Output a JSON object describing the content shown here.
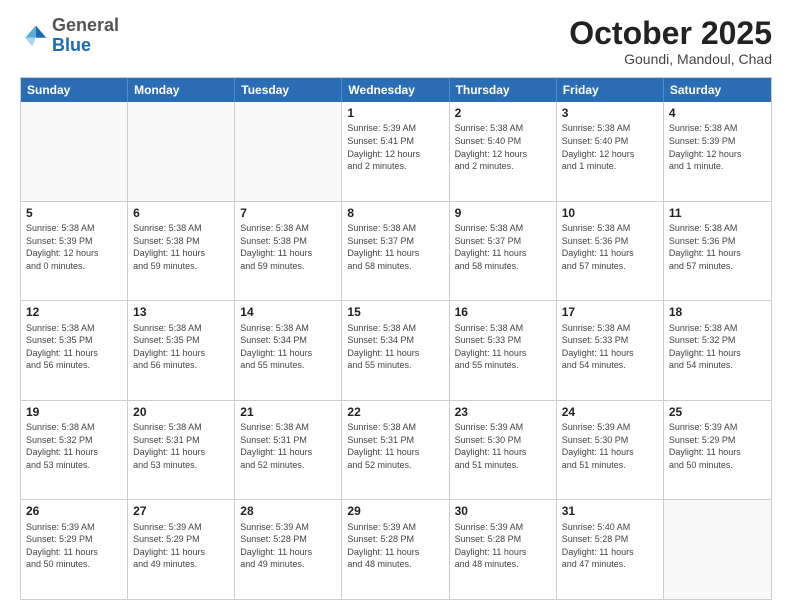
{
  "header": {
    "logo_general": "General",
    "logo_blue": "Blue",
    "month_title": "October 2025",
    "location": "Goundi, Mandoul, Chad"
  },
  "weekdays": [
    "Sunday",
    "Monday",
    "Tuesday",
    "Wednesday",
    "Thursday",
    "Friday",
    "Saturday"
  ],
  "rows": [
    [
      {
        "day": "",
        "info": ""
      },
      {
        "day": "",
        "info": ""
      },
      {
        "day": "",
        "info": ""
      },
      {
        "day": "1",
        "info": "Sunrise: 5:39 AM\nSunset: 5:41 PM\nDaylight: 12 hours\nand 2 minutes."
      },
      {
        "day": "2",
        "info": "Sunrise: 5:38 AM\nSunset: 5:40 PM\nDaylight: 12 hours\nand 2 minutes."
      },
      {
        "day": "3",
        "info": "Sunrise: 5:38 AM\nSunset: 5:40 PM\nDaylight: 12 hours\nand 1 minute."
      },
      {
        "day": "4",
        "info": "Sunrise: 5:38 AM\nSunset: 5:39 PM\nDaylight: 12 hours\nand 1 minute."
      }
    ],
    [
      {
        "day": "5",
        "info": "Sunrise: 5:38 AM\nSunset: 5:39 PM\nDaylight: 12 hours\nand 0 minutes."
      },
      {
        "day": "6",
        "info": "Sunrise: 5:38 AM\nSunset: 5:38 PM\nDaylight: 11 hours\nand 59 minutes."
      },
      {
        "day": "7",
        "info": "Sunrise: 5:38 AM\nSunset: 5:38 PM\nDaylight: 11 hours\nand 59 minutes."
      },
      {
        "day": "8",
        "info": "Sunrise: 5:38 AM\nSunset: 5:37 PM\nDaylight: 11 hours\nand 58 minutes."
      },
      {
        "day": "9",
        "info": "Sunrise: 5:38 AM\nSunset: 5:37 PM\nDaylight: 11 hours\nand 58 minutes."
      },
      {
        "day": "10",
        "info": "Sunrise: 5:38 AM\nSunset: 5:36 PM\nDaylight: 11 hours\nand 57 minutes."
      },
      {
        "day": "11",
        "info": "Sunrise: 5:38 AM\nSunset: 5:36 PM\nDaylight: 11 hours\nand 57 minutes."
      }
    ],
    [
      {
        "day": "12",
        "info": "Sunrise: 5:38 AM\nSunset: 5:35 PM\nDaylight: 11 hours\nand 56 minutes."
      },
      {
        "day": "13",
        "info": "Sunrise: 5:38 AM\nSunset: 5:35 PM\nDaylight: 11 hours\nand 56 minutes."
      },
      {
        "day": "14",
        "info": "Sunrise: 5:38 AM\nSunset: 5:34 PM\nDaylight: 11 hours\nand 55 minutes."
      },
      {
        "day": "15",
        "info": "Sunrise: 5:38 AM\nSunset: 5:34 PM\nDaylight: 11 hours\nand 55 minutes."
      },
      {
        "day": "16",
        "info": "Sunrise: 5:38 AM\nSunset: 5:33 PM\nDaylight: 11 hours\nand 55 minutes."
      },
      {
        "day": "17",
        "info": "Sunrise: 5:38 AM\nSunset: 5:33 PM\nDaylight: 11 hours\nand 54 minutes."
      },
      {
        "day": "18",
        "info": "Sunrise: 5:38 AM\nSunset: 5:32 PM\nDaylight: 11 hours\nand 54 minutes."
      }
    ],
    [
      {
        "day": "19",
        "info": "Sunrise: 5:38 AM\nSunset: 5:32 PM\nDaylight: 11 hours\nand 53 minutes."
      },
      {
        "day": "20",
        "info": "Sunrise: 5:38 AM\nSunset: 5:31 PM\nDaylight: 11 hours\nand 53 minutes."
      },
      {
        "day": "21",
        "info": "Sunrise: 5:38 AM\nSunset: 5:31 PM\nDaylight: 11 hours\nand 52 minutes."
      },
      {
        "day": "22",
        "info": "Sunrise: 5:38 AM\nSunset: 5:31 PM\nDaylight: 11 hours\nand 52 minutes."
      },
      {
        "day": "23",
        "info": "Sunrise: 5:39 AM\nSunset: 5:30 PM\nDaylight: 11 hours\nand 51 minutes."
      },
      {
        "day": "24",
        "info": "Sunrise: 5:39 AM\nSunset: 5:30 PM\nDaylight: 11 hours\nand 51 minutes."
      },
      {
        "day": "25",
        "info": "Sunrise: 5:39 AM\nSunset: 5:29 PM\nDaylight: 11 hours\nand 50 minutes."
      }
    ],
    [
      {
        "day": "26",
        "info": "Sunrise: 5:39 AM\nSunset: 5:29 PM\nDaylight: 11 hours\nand 50 minutes."
      },
      {
        "day": "27",
        "info": "Sunrise: 5:39 AM\nSunset: 5:29 PM\nDaylight: 11 hours\nand 49 minutes."
      },
      {
        "day": "28",
        "info": "Sunrise: 5:39 AM\nSunset: 5:28 PM\nDaylight: 11 hours\nand 49 minutes."
      },
      {
        "day": "29",
        "info": "Sunrise: 5:39 AM\nSunset: 5:28 PM\nDaylight: 11 hours\nand 48 minutes."
      },
      {
        "day": "30",
        "info": "Sunrise: 5:39 AM\nSunset: 5:28 PM\nDaylight: 11 hours\nand 48 minutes."
      },
      {
        "day": "31",
        "info": "Sunrise: 5:40 AM\nSunset: 5:28 PM\nDaylight: 11 hours\nand 47 minutes."
      },
      {
        "day": "",
        "info": ""
      }
    ]
  ]
}
